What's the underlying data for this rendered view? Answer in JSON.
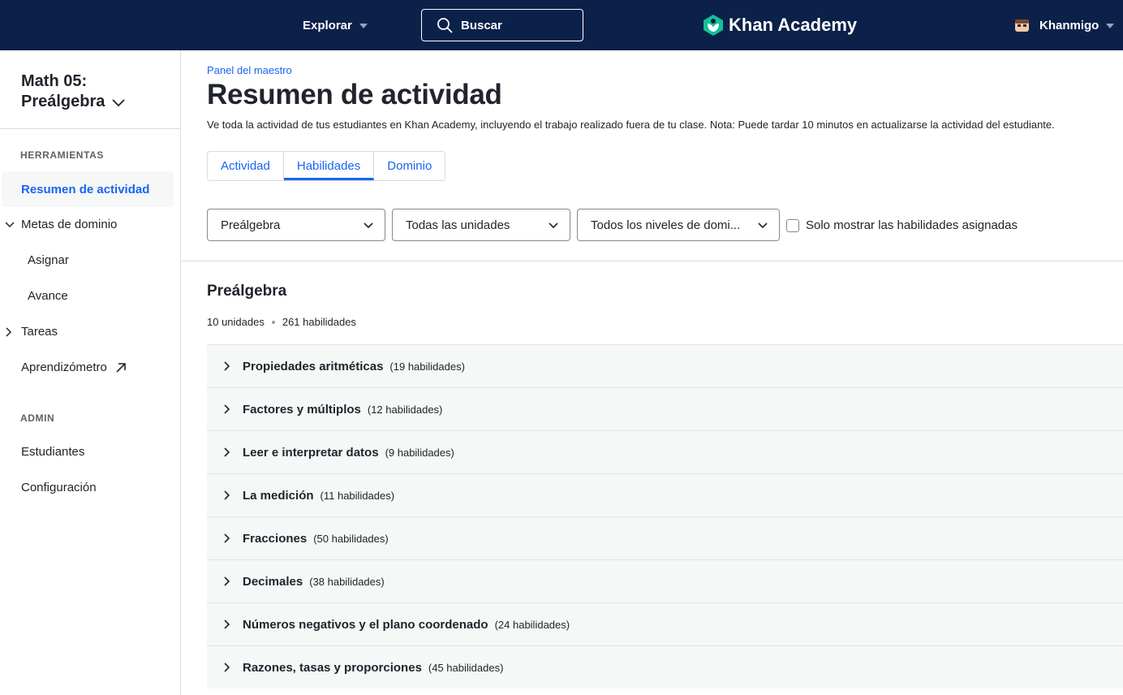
{
  "header": {
    "explore_label": "Explorar",
    "search_label": "Buscar",
    "logo_text": "Khan Academy",
    "user_label": "Khanmigo"
  },
  "sidebar": {
    "class_name_line1": "Math 05:",
    "class_name_line2": "Preálgebra",
    "tools_section": "HERRAMIENTAS",
    "items": [
      {
        "label": "Resumen de actividad"
      },
      {
        "label": "Metas de dominio"
      },
      {
        "label": "Asignar"
      },
      {
        "label": "Avance"
      },
      {
        "label": "Tareas"
      },
      {
        "label": "Aprendizómetro"
      }
    ],
    "admin_section": "ADMIN",
    "admin_items": [
      {
        "label": "Estudiantes"
      },
      {
        "label": "Configuración"
      }
    ]
  },
  "main": {
    "breadcrumb": "Panel del maestro",
    "title": "Resumen de actividad",
    "description": "Ve toda la actividad de tus estudiantes en Khan Academy, incluyendo el trabajo realizado fuera de tu clase. Nota: Puede tardar 10 minutos en actualizarse la actividad del estudiante.",
    "tabs": [
      {
        "label": "Actividad"
      },
      {
        "label": "Habilidades"
      },
      {
        "label": "Dominio"
      }
    ],
    "filters": {
      "course": "Preálgebra",
      "units": "Todas las unidades",
      "mastery": "Todos los niveles de domi...",
      "checkbox_label": "Solo mostrar las habilidades asignadas"
    },
    "course_title": "Preálgebra",
    "unit_count": "10 unidades",
    "skill_count": "261 habilidades",
    "units": [
      {
        "name": "Propiedades aritméticas",
        "count": "(19 habilidades)"
      },
      {
        "name": "Factores y múltiplos",
        "count": "(12 habilidades)"
      },
      {
        "name": "Leer e interpretar datos",
        "count": "(9 habilidades)"
      },
      {
        "name": "La medición",
        "count": "(11 habilidades)"
      },
      {
        "name": "Fracciones",
        "count": "(50 habilidades)"
      },
      {
        "name": "Decimales",
        "count": "(38 habilidades)"
      },
      {
        "name": "Números negativos y el plano coordenado",
        "count": "(24 habilidades)"
      },
      {
        "name": "Razones, tasas y proporciones",
        "count": "(45 habilidades)"
      }
    ]
  },
  "colors": {
    "topbar": "#0b2149",
    "accent": "#1865f2",
    "logo_green": "#14bf96"
  }
}
